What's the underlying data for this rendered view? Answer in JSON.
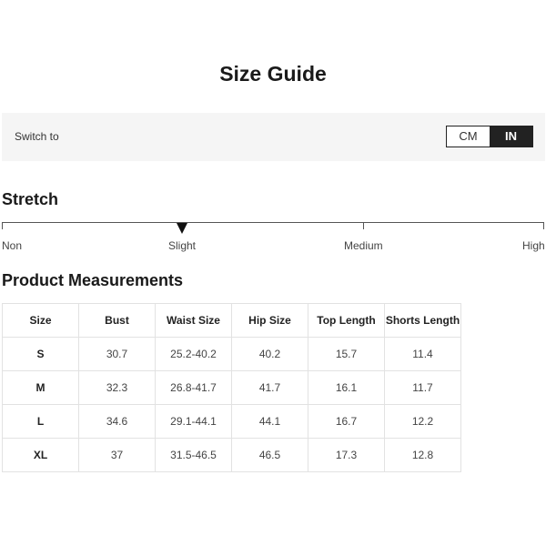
{
  "page": {
    "title": "Size Guide"
  },
  "unit_switch": {
    "label": "Switch to",
    "options": [
      "CM",
      "IN"
    ],
    "selected": "IN"
  },
  "stretch": {
    "heading": "Stretch",
    "levels": [
      "Non",
      "Slight",
      "Medium",
      "High"
    ],
    "selected": "Slight"
  },
  "measurements": {
    "heading": "Product Measurements",
    "columns": [
      "Size",
      "Bust",
      "Waist Size",
      "Hip Size",
      "Top Length",
      "Shorts Length"
    ],
    "rows": [
      [
        "S",
        "30.7",
        "25.2-40.2",
        "40.2",
        "15.7",
        "11.4"
      ],
      [
        "M",
        "32.3",
        "26.8-41.7",
        "41.7",
        "16.1",
        "11.7"
      ],
      [
        "L",
        "34.6",
        "29.1-44.1",
        "44.1",
        "16.7",
        "12.2"
      ],
      [
        "XL",
        "37",
        "31.5-46.5",
        "46.5",
        "17.3",
        "12.8"
      ]
    ]
  }
}
